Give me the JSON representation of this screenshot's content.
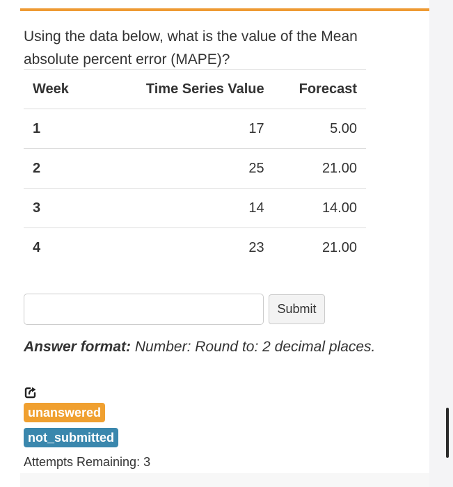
{
  "question": {
    "text": "Using the data below, what is the value of the Mean absolute percent error (MAPE)?"
  },
  "table": {
    "headers": {
      "week": "Week",
      "value": "Time Series Value",
      "forecast": "Forecast"
    },
    "rows": [
      {
        "week": "1",
        "value": "17",
        "forecast": "5.00"
      },
      {
        "week": "2",
        "value": "25",
        "forecast": "21.00"
      },
      {
        "week": "3",
        "value": "14",
        "forecast": "14.00"
      },
      {
        "week": "4",
        "value": "23",
        "forecast": "21.00"
      }
    ]
  },
  "answer": {
    "value": "",
    "submit_label": "Submit"
  },
  "format": {
    "label": "Answer format:",
    "text": "Number: Round to: 2 decimal places."
  },
  "status": {
    "share_icon": "share-icon",
    "answer_badge": "unanswered",
    "submit_badge": "not_submitted",
    "attempts": "Attempts Remaining: 3"
  },
  "colors": {
    "accent": "#ee9a33",
    "badge_unanswered": "#f0a030",
    "badge_not_submitted": "#3a87ad"
  }
}
